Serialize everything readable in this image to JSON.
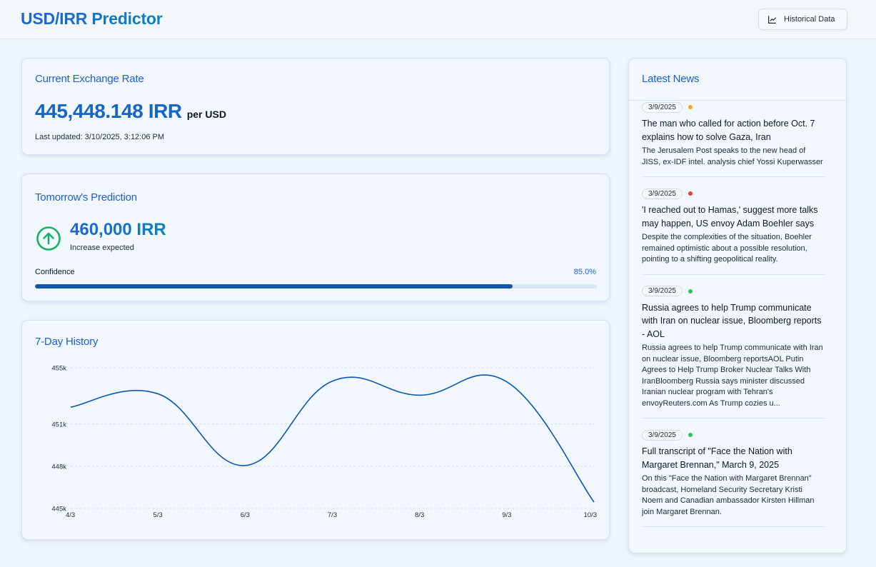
{
  "header": {
    "title": "USD/IRR Predictor",
    "historical_button": "Historical Data",
    "historical_icon": "line-chart-icon"
  },
  "current_rate": {
    "title": "Current Exchange Rate",
    "value": "445,448.148 IRR",
    "unit": "per USD",
    "last_updated": "Last updated: 3/10/2025, 3:12:06 PM"
  },
  "prediction": {
    "title": "Tomorrow's Prediction",
    "value": "460,000 IRR",
    "subtitle": "Increase expected",
    "icon": "arrow-up-circle-icon",
    "icon_color": "#16b365",
    "confidence_label": "Confidence",
    "confidence_text": "85.0%",
    "confidence": 0.85
  },
  "history": {
    "title": "7-Day History"
  },
  "chart_data": {
    "type": "line",
    "categories": [
      "4/3",
      "5/3",
      "6/3",
      "7/3",
      "8/3",
      "9/3",
      "10/3"
    ],
    "values": [
      452200,
      453150,
      448050,
      454050,
      453050,
      454000,
      445450
    ],
    "y_ticks": [
      455000,
      451000,
      448000,
      445000
    ],
    "y_tick_labels": [
      "455k",
      "451k",
      "448k",
      "445k"
    ],
    "ylim": [
      445000,
      455000
    ],
    "grid": true,
    "line_color": "#0d57b0"
  },
  "news": {
    "title": "Latest News",
    "items": [
      {
        "date": "3/9/2025",
        "dot_color": "#f5a524",
        "title": "The man who called for action before Oct. 7 explains how to solve Gaza, Iran",
        "description": "The Jerusalem Post speaks to the new head of JISS, ex-IDF intel. analysis chief Yossi Kuperwasser"
      },
      {
        "date": "3/9/2025",
        "dot_color": "#e53e3e",
        "title": "'I reached out to Hamas,' suggest more talks may happen, US envoy Adam Boehler says",
        "description": "Despite the complexities of the situation, Boehler remained optimistic about a possible resolution, pointing to a shifting geopolitical reality."
      },
      {
        "date": "3/9/2025",
        "dot_color": "#22c55e",
        "title": "Russia agrees to help Trump communicate with Iran on nuclear issue, Bloomberg reports - AOL",
        "description": "Russia agrees to help Trump communicate with Iran on nuclear issue, Bloomberg reportsAOL Putin Agrees to Help Trump Broker Nuclear Talks With IranBloomberg Russia says minister discussed Iranian nuclear program with Tehran's envoyReuters.com As Trump cozies u..."
      },
      {
        "date": "3/9/2025",
        "dot_color": "#22c55e",
        "title": "Full transcript of \"Face the Nation with Margaret Brennan,\" March 9, 2025",
        "description": "On this \"Face the Nation with Margaret Brennan\" broadcast, Homeland Security Secretary Kristi Noem and Canadian ambassador Kirsten Hillman join Margaret Brennan."
      }
    ]
  }
}
